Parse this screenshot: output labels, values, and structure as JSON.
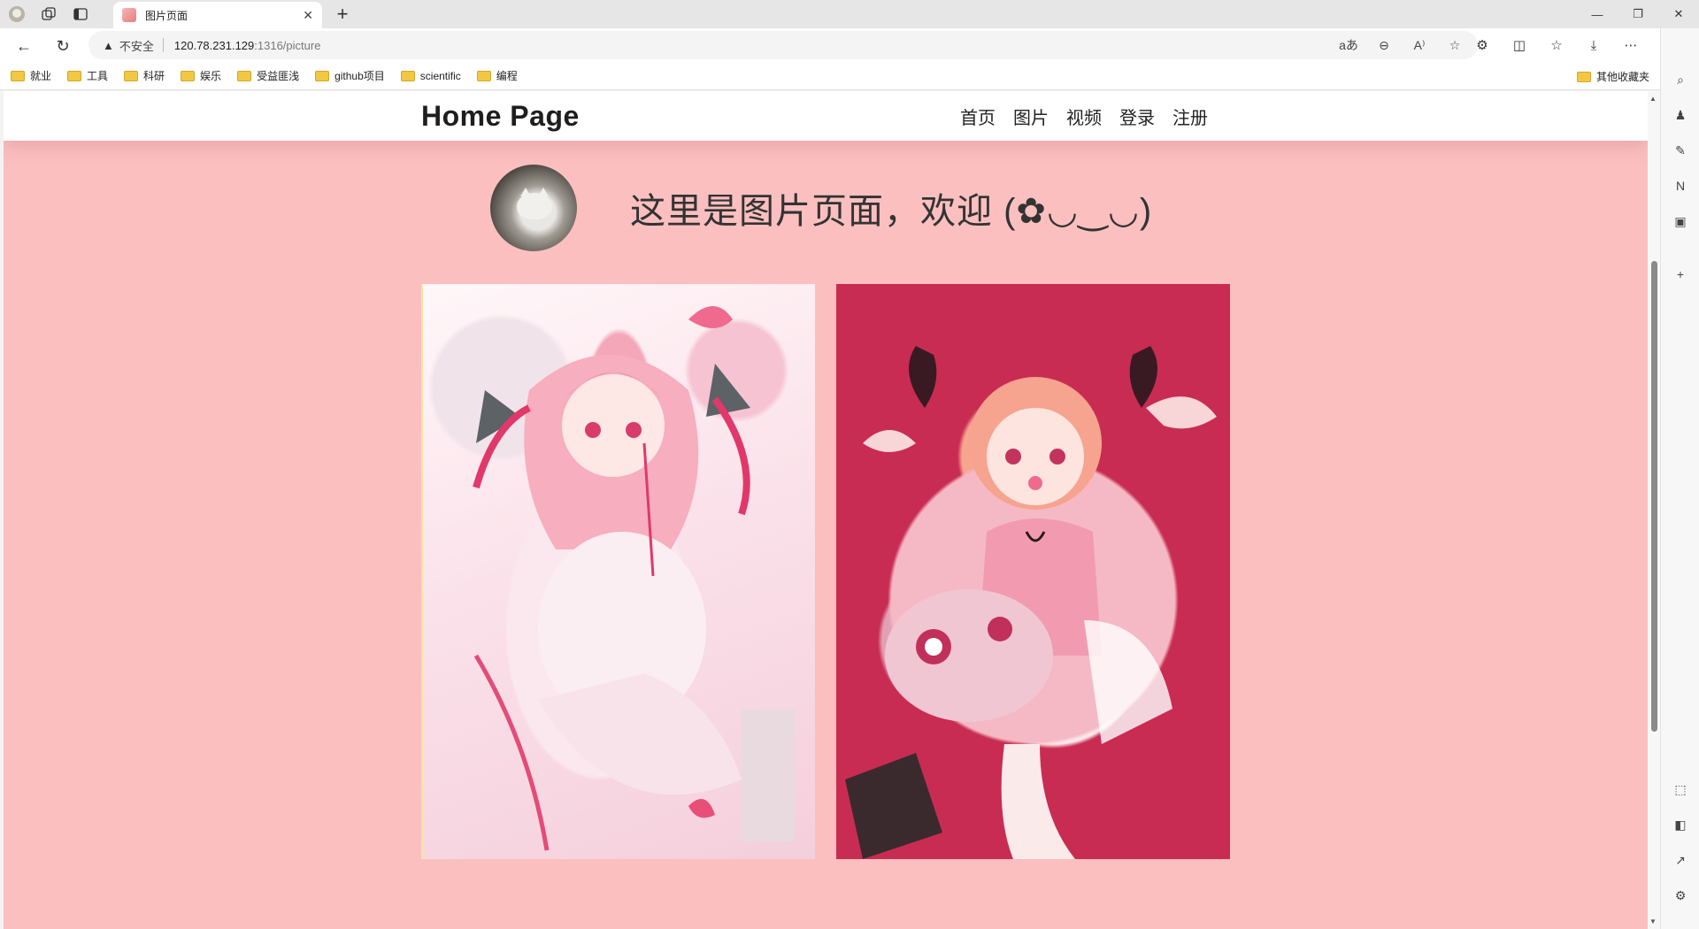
{
  "browser": {
    "tab_title": "图片页面",
    "url_warning": "不安全",
    "url_host": "120.78.231.129",
    "url_path": ":1316/picture",
    "bookmarks": [
      "就业",
      "工具",
      "科研",
      "娱乐",
      "受益匪浅",
      "github项目",
      "scientific",
      "编程"
    ],
    "other_bookmarks": "其他收藏夹"
  },
  "site": {
    "logo": "Home Page",
    "nav": [
      "首页",
      "图片",
      "视频",
      "登录",
      "注册"
    ],
    "welcome": "这里是图片页面，欢迎 (✿◡‿◡)"
  },
  "colors": {
    "page_background": "#fbbfc0",
    "header_background": "#ffffff",
    "art2_background": "#c92c52"
  },
  "icons": [
    "back-icon",
    "refresh-icon",
    "warning-icon",
    "translate-icon",
    "zoom-out-icon",
    "read-aloud-icon",
    "favorite-icon",
    "extensions-icon",
    "split-screen-icon",
    "collections-icon",
    "download-icon",
    "more-icon",
    "copilot-icon"
  ]
}
